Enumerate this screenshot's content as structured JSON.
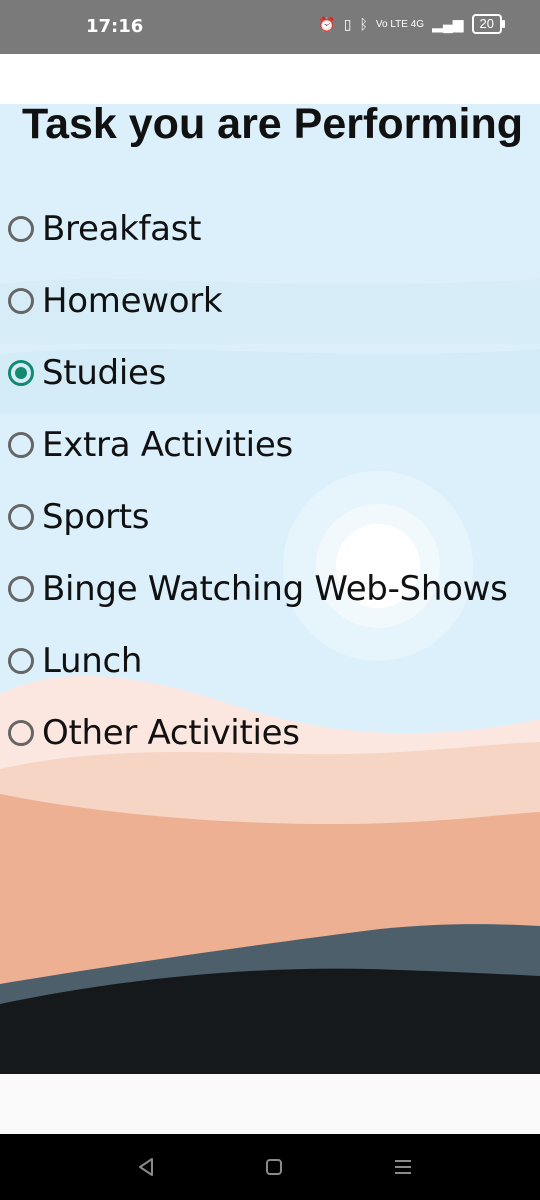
{
  "status_bar": {
    "time": "17:16",
    "network": "Vo LTE 4G",
    "battery": "20"
  },
  "page": {
    "title": "Task you are Performing"
  },
  "options": [
    {
      "label": "Breakfast",
      "checked": false
    },
    {
      "label": "Homework",
      "checked": false
    },
    {
      "label": "Studies",
      "checked": true
    },
    {
      "label": "Extra Activities",
      "checked": false
    },
    {
      "label": "Sports",
      "checked": false
    },
    {
      "label": "Binge Watching Web-Shows",
      "checked": false
    },
    {
      "label": "Lunch",
      "checked": false
    },
    {
      "label": "Other Activities",
      "checked": false
    }
  ],
  "colors": {
    "radio_selected": "#138a70",
    "radio_unselected": "#666666",
    "sky": "#dcf0fb",
    "sand_light": "#f7d5c4",
    "sand_dark": "#edb093",
    "hill_slate": "#4d5f6b",
    "hill_dark": "#16191c"
  }
}
